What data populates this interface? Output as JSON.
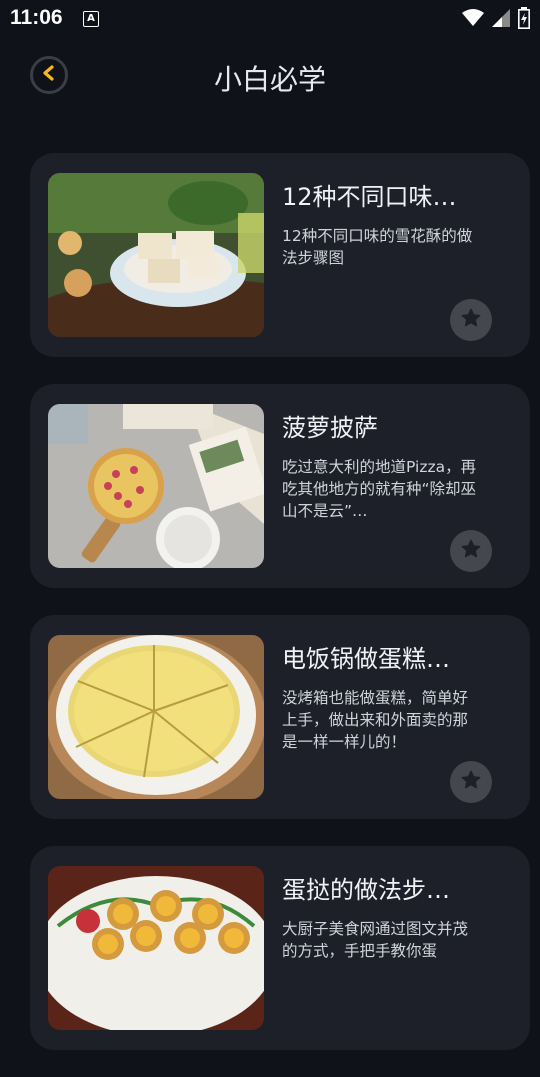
{
  "status": {
    "time": "11:06",
    "badge": "A"
  },
  "header": {
    "title": "小白必学"
  },
  "recipes": [
    {
      "title": "12种不同口味…",
      "desc": "12种不同口味的雪花酥的做法步骤图"
    },
    {
      "title": "菠萝披萨",
      "desc": "吃过意大利的地道Pizza，再吃其他地方的就有种“除却巫山不是云”…"
    },
    {
      "title": "电饭锅做蛋糕…",
      "desc": "没烤箱也能做蛋糕，简单好上手，做出来和外面卖的那是一样一样儿的！"
    },
    {
      "title": "蛋挞的做法步…",
      "desc": "大厨子美食网通过图文并茂的方式，手把手教你蛋"
    }
  ],
  "colors": {
    "accent": "#f6b81a",
    "background": "#0f1218",
    "card": "#1d2028"
  }
}
